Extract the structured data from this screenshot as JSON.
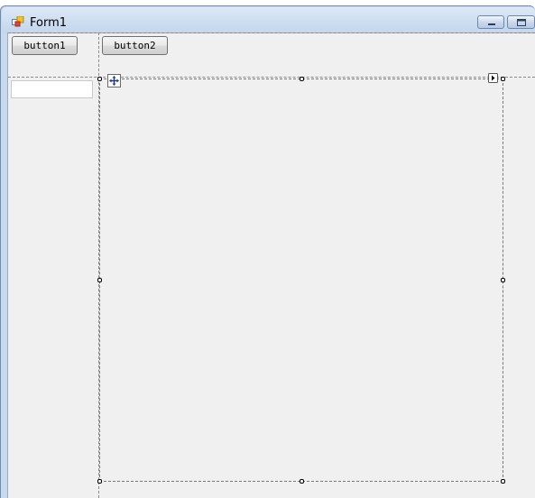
{
  "window": {
    "title": "Form1",
    "icon": "form-icon",
    "controls": [
      "minimize-icon",
      "maximize-icon"
    ]
  },
  "toolbar": {
    "button1_label": "button1",
    "button2_label": "button2"
  },
  "textbox": {
    "value": ""
  },
  "designer": {
    "selected_control": "panel",
    "glyphs": [
      "move-icon",
      "smart-tag-icon"
    ]
  }
}
